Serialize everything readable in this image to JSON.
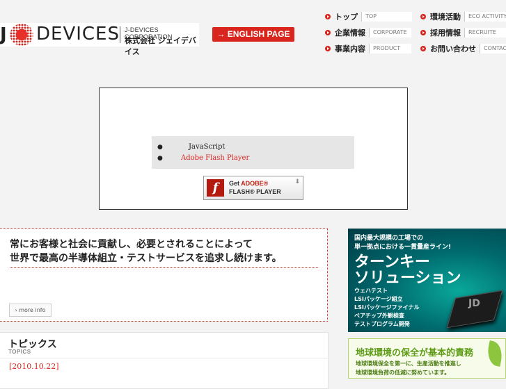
{
  "header": {
    "logo": {
      "mark": "J",
      "brand": "DEVICES",
      "corp_en": "J-DEVICES CORPORATION",
      "corp_ja": "株式会社 ジェイデバイス"
    },
    "english_button": "→ ENGLISH PAGE"
  },
  "nav": {
    "col1": [
      {
        "ja": "トップ",
        "en": "TOP"
      },
      {
        "ja": "企業情報",
        "en": "CORPORATE"
      },
      {
        "ja": "事業内容",
        "en": "PRODUCT"
      }
    ],
    "col2": [
      {
        "ja": "環境活動",
        "en": "ECO ACTIVITY"
      },
      {
        "ja": "採用情報",
        "en": "RECRUITE"
      },
      {
        "ja": "お問い合わせ",
        "en": "CONTACT"
      }
    ]
  },
  "flash": {
    "requirements": [
      "JavaScript",
      "Adobe Flash Player"
    ],
    "colors": {
      "link": "#d8261f"
    },
    "badge": {
      "line1_prefix": "Get ",
      "line1_brand": "ADOBE®",
      "line2": "FLASH® PLAYER",
      "logo_letter": "f"
    }
  },
  "message": {
    "line1": "常にお客様と社会に貢献し、必要とされることによって",
    "line2": "世界で最高の半導体組立・テストサービスを追求し続けます。",
    "more_info": "more info"
  },
  "topics": {
    "heading": "トピックス",
    "sub": "TOPICS",
    "date": "[2010.10.22]"
  },
  "turnkey": {
    "small1": "国内最大規模の工場での",
    "small2": "単一拠点における一貫量産ライン!",
    "big1": "ターンキー",
    "big2": "ソリューション",
    "items": [
      "ウェハテスト",
      "LSIパッケージ組立",
      "LSIパッケージファイナル",
      "ベアチップ外観検査",
      "テストプログラム開発"
    ],
    "chip_logo": "JD"
  },
  "eco": {
    "title": "地球環境の保全が基本的責務",
    "line1": "地球環境保全を第一に、生産活動を推進し",
    "line2": "地球環境負荷の低減に努めています。"
  }
}
